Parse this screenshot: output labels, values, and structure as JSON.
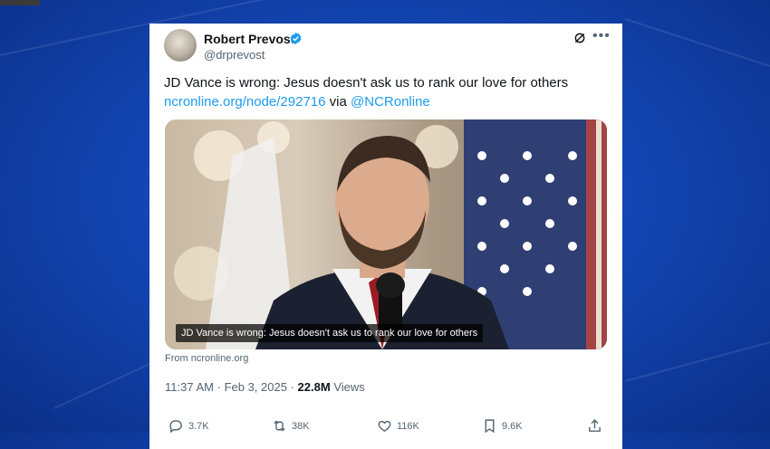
{
  "tweet": {
    "author_name": "Robert Prevost",
    "handle": "@drprevost",
    "text": "JD Vance is wrong: Jesus doesn't ask us to rank our love for others",
    "link_url": "ncronline.org/node/292716",
    "via_text": "via",
    "via_handle": "@NCRonline",
    "media_caption": "JD Vance is wrong: Jesus doesn't ask us to rank our love for others",
    "source": "From ncronline.org",
    "time": "11:37 AM",
    "date": "Feb 3, 2025",
    "separator": "·",
    "views_count": "22.8M",
    "views_label": "Views",
    "replies": "3.7K",
    "reposts": "38K",
    "likes": "116K",
    "bookmarks": "9.6K"
  },
  "colors": {
    "verified": "#1d9bf0",
    "link": "#1d9bf0",
    "background": "#1448b8"
  },
  "icons": [
    "verified-badge-icon",
    "grok-icon",
    "more-icon",
    "reply-icon",
    "repost-icon",
    "like-icon",
    "bookmark-icon",
    "share-icon"
  ]
}
